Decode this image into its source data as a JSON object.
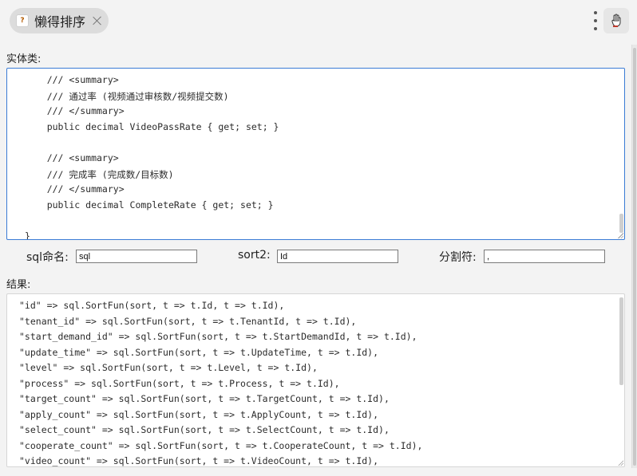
{
  "tab": {
    "title": "懒得排序",
    "favicon": "?"
  },
  "toolbar": {
    "more_icon": "kebab-menu-icon",
    "extension_icon": "extension-hand-icon"
  },
  "entity_label": "实体类:",
  "entity_code": [
    "    /// <summary>",
    "    /// 通过率 (视频通过审核数/视频提交数)",
    "    /// </summary>",
    "    public decimal VideoPassRate { get; set; }",
    "",
    "    /// <summary>",
    "    /// 完成率 (完成数/目标数)",
    "    /// </summary>",
    "    public decimal CompleteRate { get; set; }",
    "",
    "}"
  ],
  "fields": {
    "sql_name": {
      "label": "sql命名:",
      "value": "sql"
    },
    "sort2": {
      "label": "sort2:",
      "value": "Id"
    },
    "separator": {
      "label": "分割符:",
      "value": ","
    }
  },
  "result_label": "结果:",
  "result_lines": [
    "\"id\" => sql.SortFun(sort, t => t.Id, t => t.Id),",
    "\"tenant_id\" => sql.SortFun(sort, t => t.TenantId, t => t.Id),",
    "\"start_demand_id\" => sql.SortFun(sort, t => t.StartDemandId, t => t.Id),",
    "\"update_time\" => sql.SortFun(sort, t => t.UpdateTime, t => t.Id),",
    "\"level\" => sql.SortFun(sort, t => t.Level, t => t.Id),",
    "\"process\" => sql.SortFun(sort, t => t.Process, t => t.Id),",
    "\"target_count\" => sql.SortFun(sort, t => t.TargetCount, t => t.Id),",
    "\"apply_count\" => sql.SortFun(sort, t => t.ApplyCount, t => t.Id),",
    "\"select_count\" => sql.SortFun(sort, t => t.SelectCount, t => t.Id),",
    "\"cooperate_count\" => sql.SortFun(sort, t => t.CooperateCount, t => t.Id),",
    "\"video_count\" => sql.SortFun(sort, t => t.VideoCount, t => t.Id),"
  ],
  "colors": {
    "focus_border": "#3a7bd5",
    "background": "#f3f3f3"
  }
}
